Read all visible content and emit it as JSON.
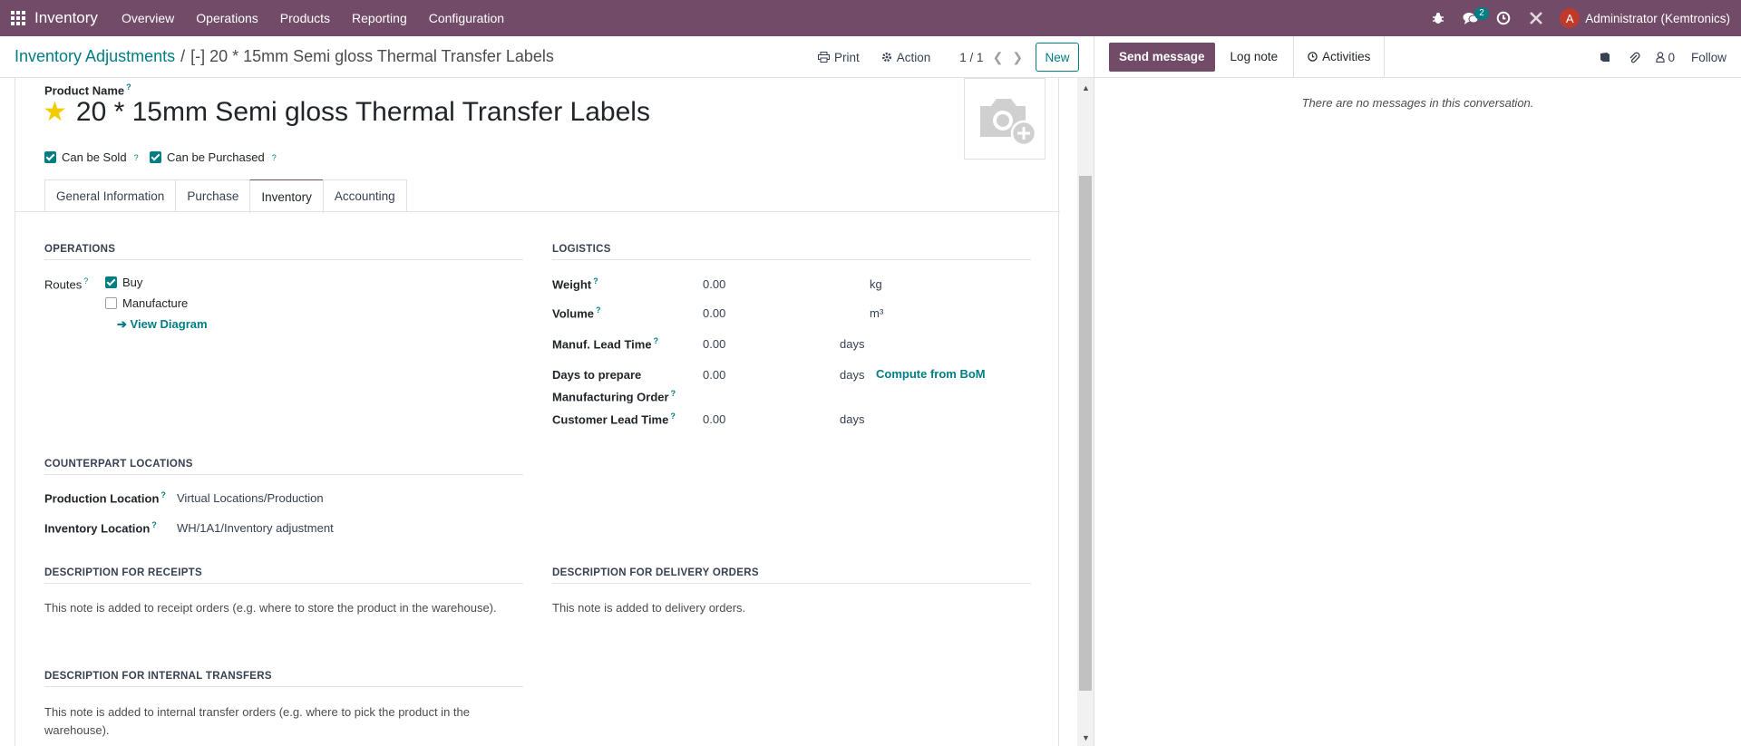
{
  "topbar": {
    "app_name": "Inventory",
    "menu": [
      "Overview",
      "Operations",
      "Products",
      "Reporting",
      "Configuration"
    ],
    "messages_badge": "2",
    "user_initial": "A",
    "user_name": "Administrator (Kemtronics)"
  },
  "control_panel": {
    "breadcrumb_parent": "Inventory Adjustments",
    "breadcrumb_separator": "/",
    "breadcrumb_current": "[-] 20 * 15mm Semi gloss Thermal Transfer Labels",
    "print_label": "Print",
    "action_label": "Action",
    "pager": "1 / 1",
    "new_label": "New"
  },
  "chatter": {
    "send_message": "Send message",
    "log_note": "Log note",
    "activities": "Activities",
    "followers_count": "0",
    "follow": "Follow",
    "empty_text": "There are no messages in this conversation."
  },
  "form": {
    "product_name_label": "Product Name",
    "product_name": "20 * 15mm Semi gloss Thermal Transfer Labels",
    "can_be_sold": "Can be Sold",
    "can_be_purchased": "Can be Purchased",
    "tabs": [
      "General Information",
      "Purchase",
      "Inventory",
      "Accounting"
    ],
    "active_tab": "Inventory",
    "operations": {
      "title": "OPERATIONS",
      "routes_label": "Routes",
      "route_buy": "Buy",
      "route_manufacture": "Manufacture",
      "view_diagram": "View Diagram"
    },
    "logistics": {
      "title": "LOGISTICS",
      "weight_label": "Weight",
      "weight_value": "0.00",
      "weight_unit": "kg",
      "volume_label": "Volume",
      "volume_value": "0.00",
      "volume_unit": "m³",
      "manuf_lead_label": "Manuf. Lead Time",
      "manuf_lead_value": "0.00",
      "manuf_lead_unit": "days",
      "days_prepare_label_1": "Days to prepare",
      "days_prepare_label_2": "Manufacturing Order",
      "days_prepare_value": "0.00",
      "days_prepare_unit": "days",
      "compute_bom": "Compute from BoM",
      "customer_lead_label": "Customer Lead Time",
      "customer_lead_value": "0.00",
      "customer_lead_unit": "days"
    },
    "counterpart": {
      "title": "COUNTERPART LOCATIONS",
      "production_label": "Production Location",
      "production_value": "Virtual Locations/Production",
      "inventory_label": "Inventory Location",
      "inventory_value": "WH/1A1/Inventory adjustment"
    },
    "receipts": {
      "title": "DESCRIPTION FOR RECEIPTS",
      "text": "This note is added to receipt orders (e.g. where to store the product in the warehouse)."
    },
    "delivery": {
      "title": "DESCRIPTION FOR DELIVERY ORDERS",
      "text": "This note is added to delivery orders."
    },
    "internal": {
      "title": "DESCRIPTION FOR INTERNAL TRANSFERS",
      "text_1": "This note is added to internal transfer orders (e.g. where to pick the product in the",
      "text_2": "warehouse)."
    }
  },
  "colors": {
    "brand": "#714b67",
    "accent": "#017e84",
    "star": "#f3cc00"
  }
}
